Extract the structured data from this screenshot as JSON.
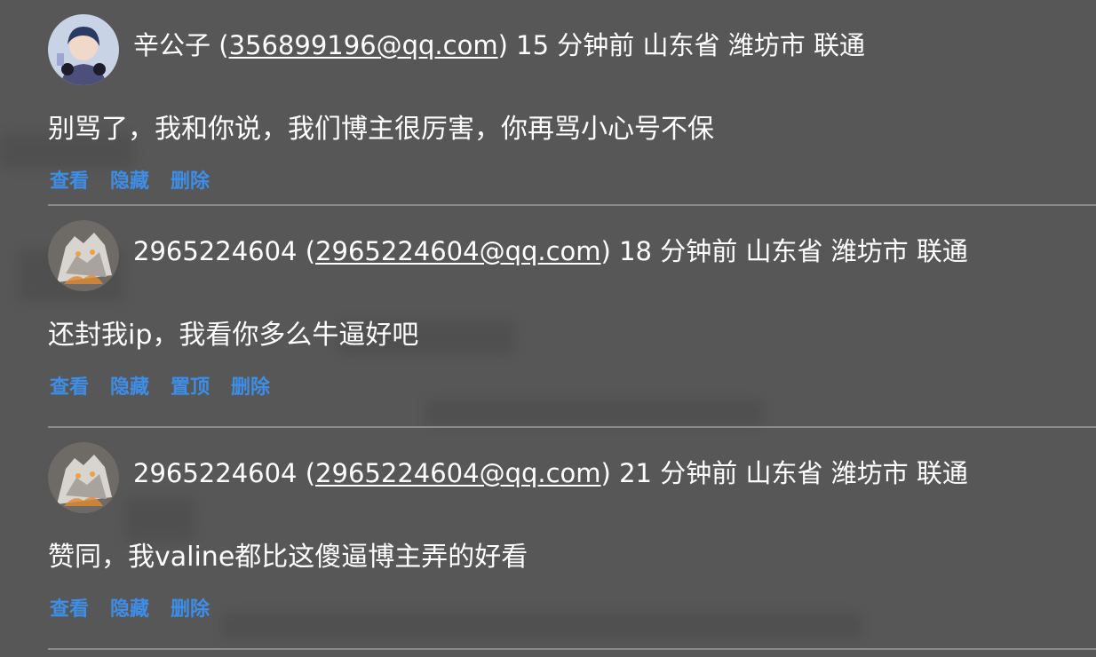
{
  "comments": [
    {
      "author": "辛公子",
      "email": "356899196@qq.com",
      "time": "15 分钟前",
      "province": "山东省",
      "city": "潍坊市",
      "isp": "联通",
      "content": "别骂了，我和你说，我们博主很厉害，你再骂小心号不保",
      "actions": [
        "查看",
        "隐藏",
        "删除"
      ],
      "avatar_icon": "anime-boy-avatar"
    },
    {
      "author": "2965224604",
      "email": "2965224604@qq.com",
      "time": "18 分钟前",
      "province": "山东省",
      "city": "潍坊市",
      "isp": "联通",
      "content": "还封我ip，我看你多么牛逼好吧",
      "actions": [
        "查看",
        "隐藏",
        "置顶",
        "删除"
      ],
      "avatar_icon": "wolf-avatar"
    },
    {
      "author": "2965224604",
      "email": "2965224604@qq.com",
      "time": "21 分钟前",
      "province": "山东省",
      "city": "潍坊市",
      "isp": "联通",
      "content": "赞同，我valine都比这傻逼博主弄的好看",
      "actions": [
        "查看",
        "隐藏",
        "删除"
      ],
      "avatar_icon": "wolf-avatar"
    }
  ],
  "colors": {
    "background": "#575757",
    "action_link": "#3d8ee8",
    "divider": "#8a8a8a"
  }
}
